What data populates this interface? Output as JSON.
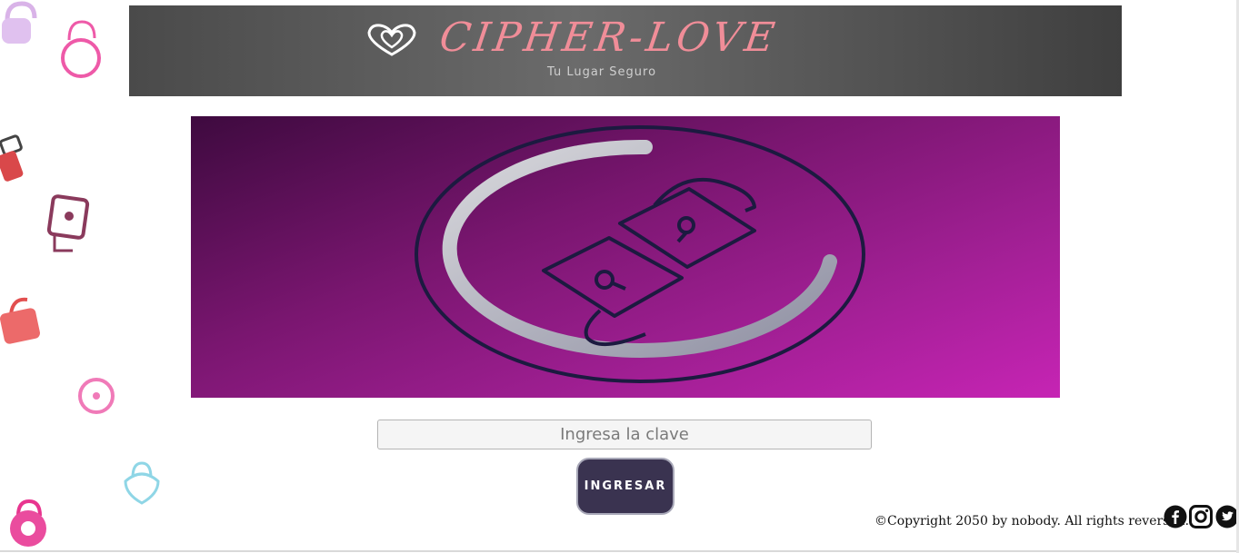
{
  "header": {
    "brand": "CIPHER-LOVE",
    "tagline": "Tu Lugar Seguro",
    "logo_icon": "heart-icon"
  },
  "hero": {
    "icon": "unlocked-padlock-icon",
    "colors": {
      "gradient_start": "#3e0a3f",
      "gradient_end": "#c624b4"
    }
  },
  "form": {
    "key_placeholder": "Ingresa la clave",
    "key_value": "",
    "submit_label": "INGRESAR"
  },
  "footer": {
    "copyright": "©Copyright 2050 by nobody. All rights reversed.",
    "social": [
      "facebook-icon",
      "instagram-icon",
      "twitter-icon"
    ]
  },
  "decorations": [
    "padlock-icon",
    "padlock-icon",
    "padlock-icon",
    "padlock-icon",
    "padlock-icon",
    "padlock-icon",
    "padlock-icon",
    "padlock-icon"
  ]
}
